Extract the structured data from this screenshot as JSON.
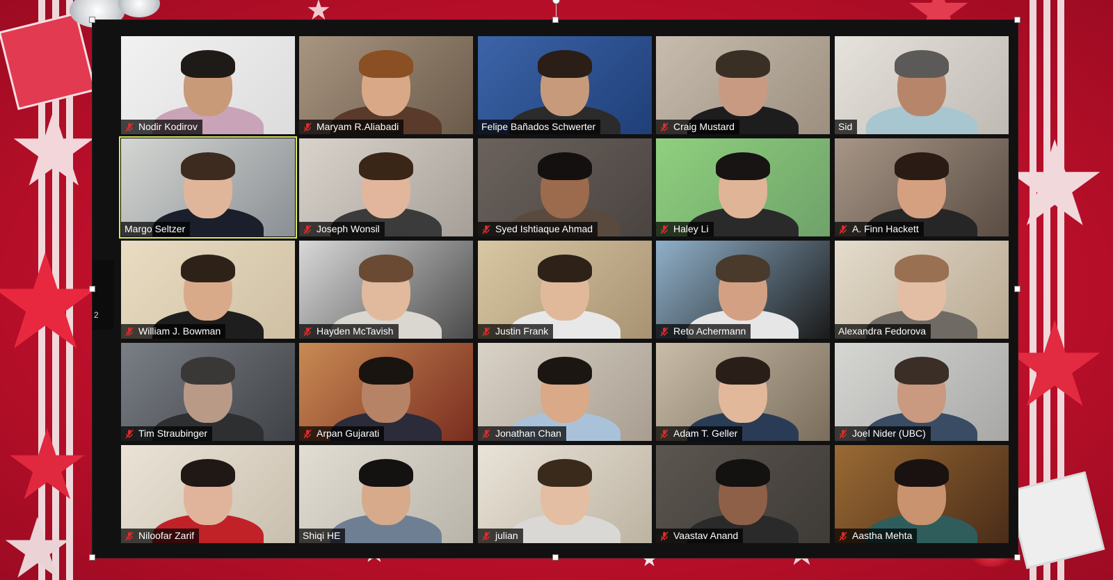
{
  "window": {
    "page_indicator": "2"
  },
  "colors": {
    "background_red": "#c8102e",
    "active_speaker_border": "#d8e85a",
    "mute_icon": "#e02b2b",
    "name_bar": "rgba(0,0,0,0.72)"
  },
  "participants": [
    {
      "name": "Nodir Kodirov",
      "muted": true,
      "bg": "#dcdcdc",
      "wall": "#f2f2f2",
      "skin": "#c99a78",
      "hair": "#1e1a18",
      "shirt": "#c9a3b8"
    },
    {
      "name": "Maryam R.Aliabadi",
      "muted": true,
      "bg": "#6b5a4a",
      "wall": "#a89581",
      "skin": "#d9a887",
      "hair": "#8a4f22",
      "shirt": "#5a3a2a"
    },
    {
      "name": "Felipe Bañados Schwerter",
      "muted": false,
      "bg": "#1f3f78",
      "wall": "#3c64a8",
      "skin": "#c79a7c",
      "hair": "#2a1e16",
      "shirt": "#2b2b2b"
    },
    {
      "name": "Craig Mustard",
      "muted": true,
      "bg": "#9c8f80",
      "wall": "#c7bcae",
      "skin": "#c99a82",
      "hair": "#3a2f25",
      "shirt": "#1d1d1d"
    },
    {
      "name": "Sid",
      "muted": false,
      "bg": "#bfbab3",
      "wall": "#e6e2dc",
      "skin": "#b7866a",
      "hair": "#5c5a58",
      "shirt": "#a7c6cf"
    },
    {
      "name": "Margo Seltzer",
      "muted": false,
      "active": true,
      "bg": "#8a8f94",
      "wall": "#d4d6d2",
      "skin": "#e0b69a",
      "hair": "#3d2b1f",
      "shirt": "#1a1f2b"
    },
    {
      "name": "Joseph Wonsil",
      "muted": true,
      "bg": "#a59f98",
      "wall": "#d9d3cc",
      "skin": "#e2b69c",
      "hair": "#3a2617",
      "shirt": "#3b3b3b"
    },
    {
      "name": "Syed Ishtiaque Ahmad",
      "muted": true,
      "bg": "#4a4441",
      "wall": "#6b625c",
      "skin": "#9c6a4c",
      "hair": "#141010",
      "shirt": "#5a4a3e"
    },
    {
      "name": "Haley Li",
      "muted": true,
      "bg": "#6fa26a",
      "wall": "#8fd07e",
      "skin": "#e0b496",
      "hair": "#181414",
      "shirt": "#2a2a2a"
    },
    {
      "name": "A. Finn Hackett",
      "muted": true,
      "bg": "#5a4c43",
      "wall": "#a79687",
      "skin": "#d4a080",
      "hair": "#2a1c14",
      "shirt": "#262626"
    },
    {
      "name": "William J. Bowman",
      "muted": true,
      "bg": "#cfc0a4",
      "wall": "#e9dcc2",
      "skin": "#d9aa8a",
      "hair": "#2e2218",
      "shirt": "#1e1e1e"
    },
    {
      "name": "Hayden McTavish",
      "muted": true,
      "bg": "#4b4b4b",
      "wall": "#d8d8d8",
      "skin": "#e1b99c",
      "hair": "#6a4a32",
      "shirt": "#dad6d0"
    },
    {
      "name": "Justin Frank",
      "muted": true,
      "bg": "#a89272",
      "wall": "#d8c7a3",
      "skin": "#e0b89a",
      "hair": "#2d2118",
      "shirt": "#e8e8e8"
    },
    {
      "name": "Reto Achermann",
      "muted": true,
      "bg": "#1a1a1a",
      "wall": "#8fb0c9",
      "skin": "#d3a083",
      "hair": "#4a3a2c",
      "shirt": "#e6e6e6"
    },
    {
      "name": "Alexandra Fedorova",
      "muted": false,
      "bg": "#b8a890",
      "wall": "#e4dccd",
      "skin": "#e4bea4",
      "hair": "#9a7052",
      "shirt": "#6f6a63"
    },
    {
      "name": "Tim Straubinger",
      "muted": true,
      "bg": "#3f4246",
      "wall": "#7a7f86",
      "skin": "#b99a86",
      "hair": "#3a3836",
      "shirt": "#2e2f31"
    },
    {
      "name": "Arpan Gujarati",
      "muted": true,
      "bg": "#7a2d1f",
      "wall": "#c98a54",
      "skin": "#b78366",
      "hair": "#1a1411",
      "shirt": "#2b2b3a"
    },
    {
      "name": "Jonathan Chan",
      "muted": true,
      "bg": "#a89d90",
      "wall": "#d9d2c7",
      "skin": "#d9a988",
      "hair": "#1c1612",
      "shirt": "#a9c2da"
    },
    {
      "name": "Adam T. Geller",
      "muted": true,
      "bg": "#7a6d5c",
      "wall": "#c9bda9",
      "skin": "#e2b89a",
      "hair": "#2a1f18",
      "shirt": "#2a3c55"
    },
    {
      "name": "Joel Nider (UBC)",
      "muted": true,
      "bg": "#a7a8a6",
      "wall": "#d6d7d3",
      "skin": "#c99a80",
      "hair": "#3a2e27",
      "shirt": "#3a4c63"
    },
    {
      "name": "Niloofar Zarif",
      "muted": true,
      "bg": "#c9bfae",
      "wall": "#eae3d6",
      "skin": "#e0b49a",
      "hair": "#1f1814",
      "shirt": "#c02228"
    },
    {
      "name": "Shiqi HE",
      "muted": false,
      "bg": "#b9b4aa",
      "wall": "#e2ddd3",
      "skin": "#d6aa8a",
      "hair": "#141111",
      "shirt": "#6f7f93"
    },
    {
      "name": "julian",
      "muted": true,
      "bg": "#bdb3a2",
      "wall": "#e9e3d8",
      "skin": "#e4bea2",
      "hair": "#3a2a1c",
      "shirt": "#dad8d4"
    },
    {
      "name": "Vaastav Anand",
      "muted": true,
      "bg": "#3e3a36",
      "wall": "#5c5650",
      "skin": "#8f6048",
      "hair": "#141111",
      "shirt": "#2a2a2a"
    },
    {
      "name": "Aastha Mehta",
      "muted": true,
      "bg": "#4a2c18",
      "wall": "#9a6a34",
      "skin": "#c8936e",
      "hair": "#1a1210",
      "shirt": "#2e5d5c"
    }
  ]
}
